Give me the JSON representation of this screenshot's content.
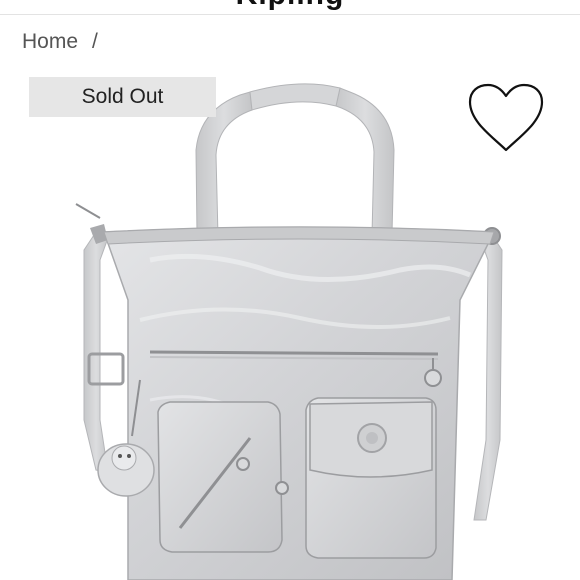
{
  "header": {
    "title_fragment": "Kipling"
  },
  "breadcrumb": {
    "home_label": "Home",
    "separator": "/"
  },
  "product": {
    "status_badge": "Sold Out",
    "colors": {
      "bag_body": "#d7d8da",
      "bag_shadow": "#b9babd",
      "bag_highlight": "#ecedef",
      "strap": "#d0d1d3",
      "badge_bg": "#e6e6e6"
    }
  },
  "icons": {
    "wishlist": "heart-outline-icon"
  }
}
